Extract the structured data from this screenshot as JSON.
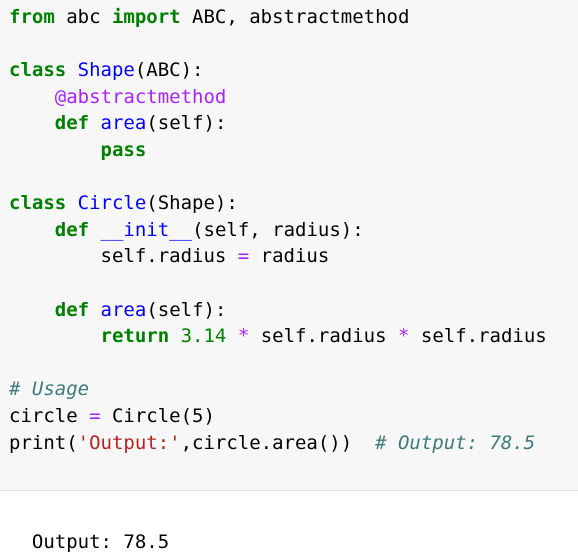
{
  "colors": {
    "keyword": "#008000",
    "name": "#0000ff",
    "decorator": "#aa22ff",
    "operator": "#aa22ff",
    "number": "#008000",
    "string": "#ba2121",
    "comment": "#3d7b7b",
    "input_background": "#f7f7f7",
    "output_background": "#ffffff"
  },
  "code_lines": [
    [
      [
        "kw",
        "from"
      ],
      [
        "plain",
        " abc "
      ],
      [
        "kw",
        "import"
      ],
      [
        "plain",
        " ABC, abstractmethod"
      ]
    ],
    [],
    [
      [
        "kw",
        "class"
      ],
      [
        "plain",
        " "
      ],
      [
        "name",
        "Shape"
      ],
      [
        "plain",
        "(ABC):"
      ]
    ],
    [
      [
        "plain",
        "    "
      ],
      [
        "deco",
        "@abstractmethod"
      ]
    ],
    [
      [
        "plain",
        "    "
      ],
      [
        "kw",
        "def"
      ],
      [
        "plain",
        " "
      ],
      [
        "name",
        "area"
      ],
      [
        "plain",
        "(self):"
      ]
    ],
    [
      [
        "plain",
        "        "
      ],
      [
        "kw",
        "pass"
      ]
    ],
    [],
    [
      [
        "kw",
        "class"
      ],
      [
        "plain",
        " "
      ],
      [
        "name",
        "Circle"
      ],
      [
        "plain",
        "(Shape):"
      ]
    ],
    [
      [
        "plain",
        "    "
      ],
      [
        "kw",
        "def"
      ],
      [
        "plain",
        " "
      ],
      [
        "name",
        "__init__"
      ],
      [
        "plain",
        "(self, radius):"
      ]
    ],
    [
      [
        "plain",
        "        self.radius "
      ],
      [
        "op",
        "="
      ],
      [
        "plain",
        " radius"
      ]
    ],
    [],
    [
      [
        "plain",
        "    "
      ],
      [
        "kw",
        "def"
      ],
      [
        "plain",
        " "
      ],
      [
        "name",
        "area"
      ],
      [
        "plain",
        "(self):"
      ]
    ],
    [
      [
        "plain",
        "        "
      ],
      [
        "kw",
        "return"
      ],
      [
        "plain",
        " "
      ],
      [
        "num",
        "3.14"
      ],
      [
        "plain",
        " "
      ],
      [
        "op",
        "*"
      ],
      [
        "plain",
        " self.radius "
      ],
      [
        "op",
        "*"
      ],
      [
        "plain",
        " self.radius"
      ]
    ],
    [],
    [
      [
        "comment",
        "# Usage"
      ]
    ],
    [
      [
        "plain",
        "circle "
      ],
      [
        "op",
        "="
      ],
      [
        "plain",
        " Circle(5)"
      ]
    ],
    [
      [
        "plain",
        "print("
      ],
      [
        "str",
        "'Output:'"
      ],
      [
        "plain",
        ",circle.area())  "
      ],
      [
        "comment",
        "# Output: 78.5"
      ]
    ]
  ],
  "output": {
    "text": "Output: 78.5"
  }
}
